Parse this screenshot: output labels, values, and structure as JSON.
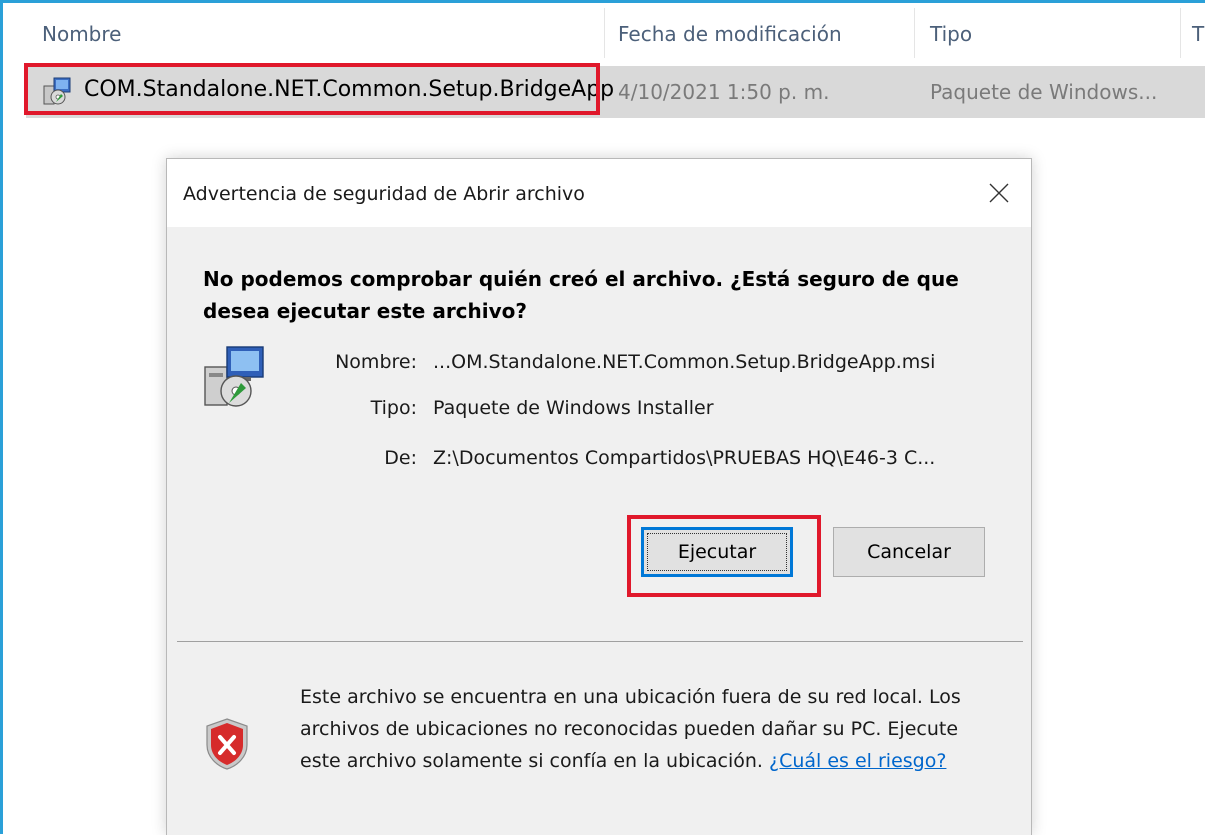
{
  "explorer": {
    "columns": {
      "name": "Nombre",
      "date_modified": "Fecha de modificación",
      "type": "Tipo",
      "size_partial": "T"
    },
    "file": {
      "name": "COM.Standalone.NET.Common.Setup.BridgeApp",
      "date_modified": "4/10/2021 1:50 p. m.",
      "type": "Paquete de Windows...",
      "icon": "windows-installer-icon"
    }
  },
  "dialog": {
    "title": "Advertencia de seguridad de Abrir archivo",
    "question": "No podemos comprobar quién creó el archivo. ¿Está seguro de que desea ejecutar este archivo?",
    "info": {
      "name_label": "Nombre:",
      "name_value": "...OM.Standalone.NET.Common.Setup.BridgeApp.msi",
      "type_label": "Tipo:",
      "type_value": "Paquete de Windows Installer",
      "from_label": "De:",
      "from_value": "Z:\\Documentos Compartidos\\PRUEBAS HQ\\E46-3 C..."
    },
    "buttons": {
      "run": "Ejecutar",
      "cancel": "Cancelar"
    },
    "warning": {
      "text": "Este archivo se encuentra en una ubicación fuera de su red local. Los archivos de ubicaciones no reconocidas pueden dañar su PC. Ejecute este archivo solamente si confía en la ubicación. ",
      "link": "¿Cuál es el riesgo?"
    }
  },
  "colors": {
    "highlight": "#e0182b",
    "frame": "#2aa0d8",
    "link": "#0066cc",
    "focus": "#0078d7"
  }
}
